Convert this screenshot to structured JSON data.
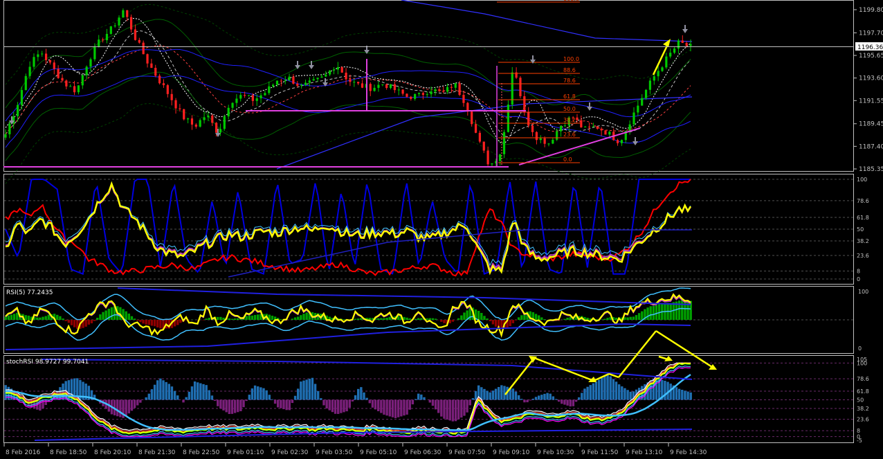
{
  "colors": {
    "background": "#000000",
    "axis": "#c0c0c0",
    "bull": "#00c800",
    "bear": "#ff2020",
    "magenta": "#e040e0",
    "fib": "#ff4000",
    "yellow": "#ffff00",
    "blue": "#0000ff",
    "lightblue": "#40c0ff",
    "red": "#ff0000",
    "green_hist": "#00a000",
    "darkred_hist": "#900000",
    "steelblue_hist": "#1f6fb2",
    "purple_hist": "#7a1f7a"
  },
  "price_panel": {
    "current_price": "1196.36",
    "price_ticks": [
      "1199.80",
      "1197.70",
      "1195.65",
      "1193.60",
      "1191.55",
      "1189.45",
      "1187.40",
      "1185.35"
    ],
    "fib_levels": [
      "161.8",
      "100.0",
      "88.6",
      "78.6",
      "61.8",
      "50.0",
      "38.2",
      "23.6",
      "0.0"
    ]
  },
  "osc_panel": {
    "ticks": [
      "100",
      "78.6",
      "61.8",
      "50",
      "38.2",
      "23.6",
      "8",
      "0"
    ]
  },
  "rsi_panel": {
    "label": "RSI(5) 77.2435",
    "ticks": [
      "100",
      "0"
    ]
  },
  "stoch_panel": {
    "label": "stochRSI 98.9727 99.7041",
    "ticks": [
      "105",
      "100",
      "78.6",
      "61.8",
      "50",
      "38.2",
      "23.6",
      "8",
      "0",
      "-5"
    ]
  },
  "time_axis": [
    "8 Feb 2016",
    "8 Feb 18:50",
    "8 Feb 20:10",
    "8 Feb 21:30",
    "8 Feb 22:50",
    "9 Feb 01:10",
    "9 Feb 02:30",
    "9 Feb 03:50",
    "9 Feb 05:10",
    "9 Feb 06:30",
    "9 Feb 07:50",
    "9 Feb 09:10",
    "9 Feb 10:30",
    "9 Feb 11:50",
    "9 Feb 13:10",
    "9 Feb 14:30"
  ],
  "chart_data": {
    "type": "line",
    "symbol_price_axis": [
      1185.35,
      1199.8
    ],
    "price_path": [
      1188.5,
      1191.2,
      1194.8,
      1196.0,
      1194.5,
      1193.1,
      1192.4,
      1195.2,
      1197.0,
      1198.1,
      1199.8,
      1197.2,
      1195.1,
      1193.4,
      1191.8,
      1190.1,
      1189.2,
      1190.3,
      1188.6,
      1191.5,
      1192.0,
      1191.6,
      1192.3,
      1193.4,
      1193.6,
      1192.8,
      1193.2,
      1193.7,
      1194.9,
      1193.4,
      1192.9,
      1192.7,
      1193.1,
      1192.5,
      1191.9,
      1192.0,
      1192.6,
      1192.2,
      1193.1,
      1191.2,
      1188.0,
      1185.6,
      1187.0,
      1195.0,
      1190.0,
      1188.2,
      1187.7,
      1189.3,
      1190.1,
      1188.9,
      1189.2,
      1188.6,
      1187.8,
      1190.0,
      1192.1,
      1193.9,
      1195.4,
      1196.8,
      1196.4
    ],
    "rsi_last": 77.2435,
    "stochrsi_last": [
      98.9727,
      99.7041
    ]
  }
}
